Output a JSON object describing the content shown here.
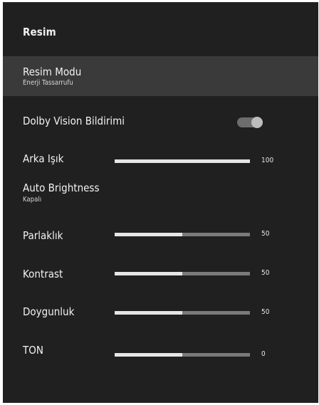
{
  "header": {
    "title": "Resim"
  },
  "settings": {
    "picture_mode": {
      "label": "Resim Modu",
      "value": "Enerji Tassarrufu"
    },
    "dolby_vision": {
      "label": "Dolby Vision Bildirimi",
      "enabled": true
    },
    "backlight": {
      "label": "Arka Işık",
      "value": "100",
      "level": 100
    },
    "auto_brightness": {
      "label": "Auto Brightness",
      "value": "Kapalı"
    },
    "brightness": {
      "label": "Parlaklık",
      "value": "50",
      "level": 50
    },
    "contrast": {
      "label": "Kontrast",
      "value": "50",
      "level": 50
    },
    "saturation": {
      "label": "Doygunluk",
      "value": "50",
      "level": 50
    },
    "tone": {
      "label": "TON",
      "value": "0",
      "level": 50
    }
  },
  "colors": {
    "panel_background": "#202020",
    "selected_row": "#3a3a3a",
    "slider_fill": "#e6e6e6",
    "slider_track": "#7a7a7a"
  }
}
